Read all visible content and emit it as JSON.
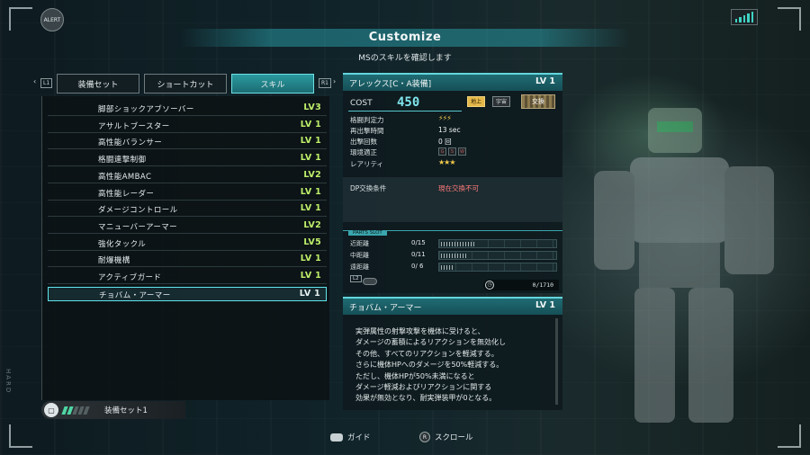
{
  "header": {
    "alert_label": "ALERT",
    "title": "Customize",
    "subtitle": "MSのスキルを確認します",
    "side_label": "HARD"
  },
  "tabs": {
    "left_hint": "L1",
    "right_hint": "R1",
    "items": [
      {
        "label": "装備セット"
      },
      {
        "label": "ショートカット"
      },
      {
        "label": "スキル",
        "active": true
      }
    ]
  },
  "skills": [
    {
      "name": "脚部ショックアブソーバー",
      "level": "LV3"
    },
    {
      "name": "アサルトブースター",
      "level": "LV 1"
    },
    {
      "name": "高性能バランサー",
      "level": "LV 1"
    },
    {
      "name": "格闘連撃制御",
      "level": "LV 1"
    },
    {
      "name": "高性能AMBAC",
      "level": "LV2"
    },
    {
      "name": "高性能レーダー",
      "level": "LV 1"
    },
    {
      "name": "ダメージコントロール",
      "level": "LV 1"
    },
    {
      "name": "マニューバーアーマー",
      "level": "LV2"
    },
    {
      "name": "強化タックル",
      "level": "LV5"
    },
    {
      "name": "耐爆機構",
      "level": "LV 1"
    },
    {
      "name": "アクティブガード",
      "level": "LV 1"
    },
    {
      "name": "チョバム・アーマー",
      "level": "LV 1",
      "selected": true
    }
  ],
  "loadout": {
    "label": "装備セット1"
  },
  "ms": {
    "name": "アレックス[C・A装備]",
    "level": "LV 1",
    "cost_label": "COST",
    "cost": "450",
    "env_ground": "地上",
    "env_space": "宇宙",
    "exchange_label": "交換",
    "stats": [
      {
        "label": "格闘判定力",
        "value": ""
      },
      {
        "label": "再出撃時間",
        "value": "13 sec"
      },
      {
        "label": "出撃回数",
        "value": "0 回"
      },
      {
        "label": "環境適正",
        "value": ""
      },
      {
        "label": "レアリティ",
        "value": ""
      }
    ],
    "rarity_stars": "★★★",
    "env_letters": [
      "G",
      "S",
      "W"
    ],
    "dp_label": "DP交換条件",
    "dp_value": "現在交換不可"
  },
  "parts_slot": {
    "title": "PARTS SLOT",
    "rows": [
      {
        "name": "近距離",
        "value": "0/15",
        "fill": 0.3
      },
      {
        "name": "中距離",
        "value": "0/11",
        "fill": 0.22
      },
      {
        "name": "遠距離",
        "value": "0/ 6",
        "fill": 0.12
      }
    ],
    "l2_hint": "L2",
    "total": "0/1710"
  },
  "detail": {
    "name": "チョバム・アーマー",
    "level": "LV 1",
    "text": "実弾属性の射撃攻撃を機体に受けると、\nダメージの蓄積によるリアクションを無効化し\nその他、すべてのリアクションを軽減する。\nさらに機体HPへのダメージを50%軽減する。\nただし、機体HPが50%未満になると\nダメージ軽減およびリアクションに関する\n効果が無効となり、耐実弾装甲が0となる。"
  },
  "footer": {
    "guide": "ガイド",
    "scroll": "スクロール"
  },
  "colors": {
    "accent": "#5fe6ee",
    "level_text": "#bff06a",
    "cost": "#7fe3ea",
    "warning": "#ff7a7a"
  }
}
